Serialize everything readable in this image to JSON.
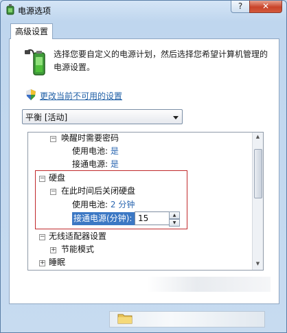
{
  "window": {
    "title": "电源选项",
    "help_label": "?",
    "close_label": "✕"
  },
  "tab": {
    "label": "高级设置"
  },
  "intro": {
    "text": "选择您要自定义的电源计划，然后选择您希望计算机管理的电源设置。"
  },
  "change_link": {
    "label": "更改当前不可用的设置"
  },
  "plan_select": {
    "value": "平衡 [活动]"
  },
  "tree": {
    "wake_password": {
      "label": "唤醒时需要密码",
      "battery_label": "使用电池:",
      "battery_value": "是",
      "ac_label": "接通电源:",
      "ac_value": "是"
    },
    "hard_disk": {
      "label": "硬盘"
    },
    "turn_off_disk": {
      "label": "在此时间后关闭硬盘",
      "battery_label": "使用电池:",
      "battery_value": "2 分钟",
      "ac_edit_label": "接通电源(分钟):",
      "ac_edit_value": "15"
    },
    "wireless": {
      "label": "无线适配器设置"
    },
    "power_saving": {
      "label": "节能模式"
    },
    "sleep": {
      "label": "睡眠"
    }
  },
  "icons": {
    "app": "power-options-icon",
    "battery": "battery-plug-icon",
    "shield": "uac-shield-icon",
    "folder": "folder-icon"
  },
  "colors": {
    "link": "#1f5fa6",
    "value": "#2a66b0",
    "highlight_border": "#c0282a",
    "selection": "#3c78c4"
  }
}
